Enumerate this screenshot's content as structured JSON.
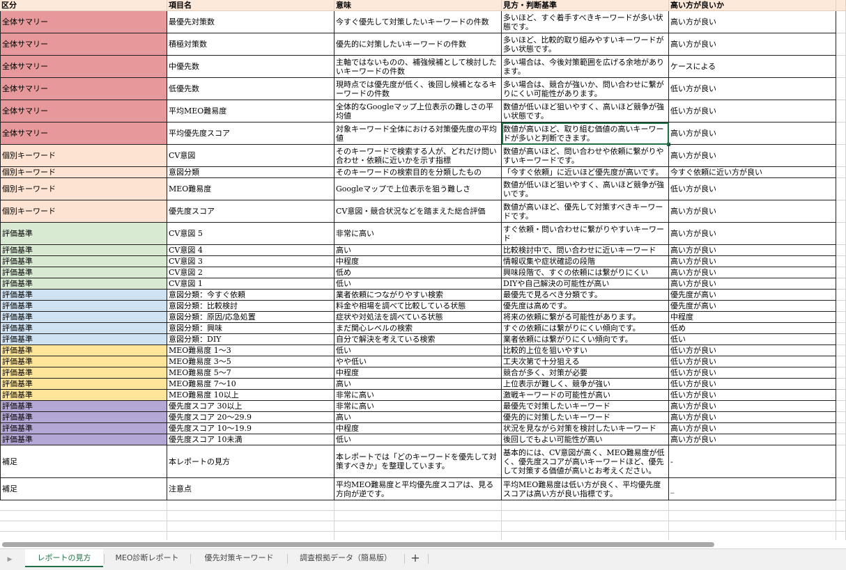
{
  "colors": {
    "summary": "#e6989b",
    "keyword": "#fde3d1",
    "cv": "#d9ead3",
    "intent": "#cfe2f3",
    "difficulty": "#ffe599",
    "priority": "#b4a7d6",
    "note": "#ffffff",
    "header": "#fde9d9",
    "active_tab": "#1e7145"
  },
  "headers": [
    "区分",
    "項目名",
    "意味",
    "見方・判断基準",
    "高い方が良いか"
  ],
  "rows": [
    {
      "cat": "全体サマリー",
      "item": "最優先対策数",
      "meaning": "今すぐ優先して対策したいキーワードの件数",
      "criteria": "多いほど、すぐ着手すべきキーワードが多い状態です。",
      "better": "高い方が良い",
      "color": "summary",
      "h": 32
    },
    {
      "cat": "全体サマリー",
      "item": "積極対策数",
      "meaning": "優先的に対策したいキーワードの件数",
      "criteria": "多いほど、比較的取り組みやすいキーワードが多い状態です。",
      "better": "高い方が良い",
      "color": "summary",
      "h": 32
    },
    {
      "cat": "全体サマリー",
      "item": "中優先数",
      "meaning": "主軸ではないものの、補強候補として検討したいキーワードの件数",
      "criteria": "多い場合は、今後対策範囲を広げる余地があります。",
      "better": "ケースによる",
      "color": "summary",
      "h": 32
    },
    {
      "cat": "全体サマリー",
      "item": "低優先数",
      "meaning": "現時点では優先度が低く、後回し候補となるキーワードの件数",
      "criteria": "多い場合は、競合が強いか、問い合わせに繋がりにくい可能性があります。",
      "better": "低い方が良い",
      "color": "summary",
      "h": 32
    },
    {
      "cat": "全体サマリー",
      "item": "平均MEO難易度",
      "meaning": "全体的なGoogleマップ上位表示の難しさの平均値",
      "criteria": "数値が低いほど狙いやすく、高いほど競争が強い状態です。",
      "better": "低い方が良い",
      "color": "summary",
      "h": 32
    },
    {
      "cat": "全体サマリー",
      "item": "平均優先度スコア",
      "meaning": "対象キーワード全体における対策優先度の平均値",
      "criteria": "数値が高いほど、取り組む価値の高いキーワードが多いと判断できます。",
      "better": "高い方が良い",
      "color": "summary",
      "h": 32,
      "selected": true
    },
    {
      "cat": "個別キーワード",
      "item": "CV意図",
      "meaning": "そのキーワードで検索する人が、どれだけ問い合わせ・依頼に近いかを示す指標",
      "criteria": "数値が高いほど、問い合わせや依頼に繋がりやすいキーワードです。",
      "better": "高い方が良い",
      "color": "keyword",
      "h": 32
    },
    {
      "cat": "個別キーワード",
      "item": "意図分類",
      "meaning": "そのキーワードの検索目的を分類したもの",
      "criteria": "「今すぐ依頼」に近いほど優先度が高いです。",
      "better": "今すぐ依頼に近い方が良い",
      "color": "keyword",
      "h": 16
    },
    {
      "cat": "個別キーワード",
      "item": "MEO難易度",
      "meaning": "Googleマップで上位表示を狙う難しさ",
      "criteria": "数値が低いほど狙いやすく、高いほど競争が強いです。",
      "better": "低い方が良い",
      "color": "keyword",
      "h": 32
    },
    {
      "cat": "個別キーワード",
      "item": "優先度スコア",
      "meaning": "CV意図・競合状況などを踏まえた総合評価",
      "criteria": "数値が高いほど、優先して対策すべきキーワードです。",
      "better": "高い方が良い",
      "color": "keyword",
      "h": 32
    },
    {
      "cat": "評価基準",
      "item": "CV意図 5",
      "meaning": "非常に高い",
      "criteria": "すぐ依頼・問い合わせに繋がりやすいキーワード",
      "better": "高い方が良い",
      "color": "cv",
      "h": 32
    },
    {
      "cat": "評価基準",
      "item": "CV意図 4",
      "meaning": "高い",
      "criteria": "比較検討中で、問い合わせに近いキーワード",
      "better": "高い方が良い",
      "color": "cv",
      "h": 16
    },
    {
      "cat": "評価基準",
      "item": "CV意図 3",
      "meaning": "中程度",
      "criteria": "情報収集や症状確認の段階",
      "better": "高い方が良い",
      "color": "cv",
      "h": 16
    },
    {
      "cat": "評価基準",
      "item": "CV意図 2",
      "meaning": "低め",
      "criteria": "興味段階で、すぐの依頼には繋がりにくい",
      "better": "高い方が良い",
      "color": "cv",
      "h": 16
    },
    {
      "cat": "評価基準",
      "item": "CV意図 1",
      "meaning": "低い",
      "criteria": "DIYや自己解決の可能性が高い",
      "better": "高い方が良い",
      "color": "cv",
      "h": 16
    },
    {
      "cat": "評価基準",
      "item": "意図分類：今すぐ依頼",
      "meaning": "業者依頼につながりやすい検索",
      "criteria": "最優先で見るべき分類です。",
      "better": "優先度が高い",
      "color": "intent",
      "h": 16
    },
    {
      "cat": "評価基準",
      "item": "意図分類：比較検討",
      "meaning": "料金や相場を調べて比較している状態",
      "criteria": "優先度は高めです。",
      "better": "優先度が高い",
      "color": "intent",
      "h": 16
    },
    {
      "cat": "評価基準",
      "item": "意図分類：原因/応急処置",
      "meaning": "症状や対処法を調べている状態",
      "criteria": "将来の依頼に繋がる可能性があります。",
      "better": "中程度",
      "color": "intent",
      "h": 16
    },
    {
      "cat": "評価基準",
      "item": "意図分類：興味",
      "meaning": "まだ関心レベルの検索",
      "criteria": "すぐの依頼には繋がりにくい傾向です。",
      "better": "低め",
      "color": "intent",
      "h": 16
    },
    {
      "cat": "評価基準",
      "item": "意図分類：DIY",
      "meaning": "自分で解決を考えている検索",
      "criteria": "業者依頼には繋がりにくい傾向です。",
      "better": "低い",
      "color": "intent",
      "h": 16
    },
    {
      "cat": "評価基準",
      "item": "MEO難易度 1〜3",
      "meaning": "低い",
      "criteria": "比較的上位を狙いやすい",
      "better": "低い方が良い",
      "color": "difficulty",
      "h": 16
    },
    {
      "cat": "評価基準",
      "item": "MEO難易度 3〜5",
      "meaning": "やや低い",
      "criteria": "工夫次第で十分狙える",
      "better": "低い方が良い",
      "color": "difficulty",
      "h": 16
    },
    {
      "cat": "評価基準",
      "item": "MEO難易度 5〜7",
      "meaning": "中程度",
      "criteria": "競合が多く、対策が必要",
      "better": "低い方が良い",
      "color": "difficulty",
      "h": 16
    },
    {
      "cat": "評価基準",
      "item": "MEO難易度 7〜10",
      "meaning": "高い",
      "criteria": "上位表示が難しく、競争が強い",
      "better": "低い方が良い",
      "color": "difficulty",
      "h": 16
    },
    {
      "cat": "評価基準",
      "item": "MEO難易度 10以上",
      "meaning": "非常に高い",
      "criteria": "激戦キーワードの可能性が高い",
      "better": "低い方が良い",
      "color": "difficulty",
      "h": 16
    },
    {
      "cat": "評価基準",
      "item": "優先度スコア 30以上",
      "meaning": "非常に高い",
      "criteria": "最優先で対策したいキーワード",
      "better": "高い方が良い",
      "color": "priority",
      "h": 16
    },
    {
      "cat": "評価基準",
      "item": "優先度スコア 20〜29.9",
      "meaning": "高い",
      "criteria": "優先的に対策したいキーワード",
      "better": "高い方が良い",
      "color": "priority",
      "h": 16
    },
    {
      "cat": "評価基準",
      "item": "優先度スコア 10〜19.9",
      "meaning": "中程度",
      "criteria": "状況を見ながら対策を検討したいキーワード",
      "better": "高い方が良い",
      "color": "priority",
      "h": 16
    },
    {
      "cat": "評価基準",
      "item": "優先度スコア 10未満",
      "meaning": "低い",
      "criteria": "後回しでもよい可能性が高い",
      "better": "高い方が良い",
      "color": "priority",
      "h": 16
    },
    {
      "cat": "補足",
      "item": "本レポートの見方",
      "meaning": "本レポートでは「どのキーワードを優先して対策すべきか」を整理しています。",
      "criteria": "基本的には、CV意図が高く、MEO難易度が低く、優先度スコアが高いキーワードほど、優先して対策する価値が高いとお考えください。",
      "better": "-",
      "color": "note",
      "h": 47
    },
    {
      "cat": "補足",
      "item": "注意点",
      "meaning": "平均MEO難易度と平均優先度スコアは、見る方向が逆です。",
      "criteria": "平均MEO難易度は低い方が良く、平均優先度スコアは高い方が良い指標です。",
      "better": "_",
      "color": "note",
      "h": 32
    }
  ],
  "sheet_tabs": [
    "レポートの見方",
    "MEO診断レポート",
    "優先対策キーワード",
    "調査根拠データ（簡易版）"
  ],
  "active_tab": 0,
  "add_sheet_label": "+",
  "nav_icon": "play-left-icon"
}
